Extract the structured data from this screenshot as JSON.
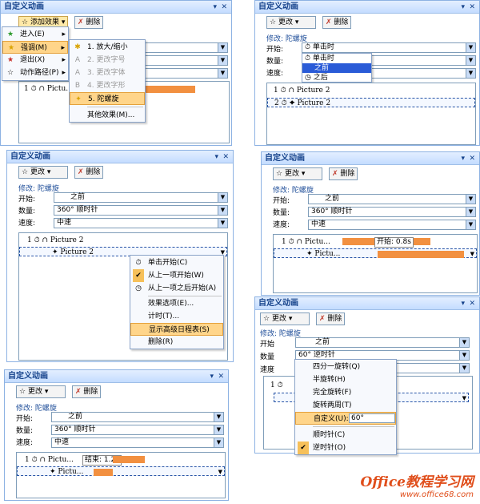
{
  "panel1": {
    "title": "自定义动画",
    "add_effect_label": "添加效果 ▾",
    "delete_label": "删除",
    "list_row": "1 ⏱ ∩ Pictu...",
    "main_menu": [
      {
        "label": "进入(E)",
        "icon": "star-green-icon"
      },
      {
        "label": "强调(M)",
        "icon": "star-yellow-icon"
      },
      {
        "label": "退出(X)",
        "icon": "star-red-icon"
      },
      {
        "label": "动作路径(P)",
        "icon": "star-outline-icon"
      }
    ],
    "submenu": [
      {
        "label": "1. 放大/缩小",
        "disabled": false
      },
      {
        "label": "2. 更改字号",
        "disabled": true
      },
      {
        "label": "3. 更改字体",
        "disabled": true
      },
      {
        "label": "4. 更改字形",
        "disabled": true
      },
      {
        "label": "5. 陀螺旋",
        "disabled": false
      },
      {
        "label": "其他效果(M)...",
        "disabled": false
      }
    ]
  },
  "panel2": {
    "title": "自定义动画",
    "change_label": "更改",
    "delete_label": "删除",
    "modify_label": "修改: 陀螺旋",
    "start_label": "开始:",
    "start_value": "单击时",
    "quantity_label": "数量:",
    "speed_label": "速度:",
    "start_options": [
      "单击时",
      "之前",
      "之后"
    ],
    "rows": [
      "1 ⏱ ∩ Picture 2",
      "2 ⏱ ✦ Picture 2"
    ]
  },
  "panel3": {
    "title": "自定义动画",
    "change_label": "更改",
    "delete_label": "删除",
    "modify_label": "修改: 陀螺旋",
    "start_label": "开始:",
    "start_value": "之前",
    "quantity_label": "数量:",
    "quantity_value": "360°  顺时针",
    "speed_label": "速度:",
    "speed_value": "中速",
    "rows": [
      "1 ⏱ ∩ Picture 2",
      "✦ Picture 2"
    ],
    "context_menu": [
      "单击开始(C)",
      "从上一项开始(W)",
      "从上一项之后开始(A)",
      "效果选项(E)...",
      "计时(T)...",
      "显示高级日程表(S)",
      "删除(R)"
    ]
  },
  "panel4": {
    "title": "自定义动画",
    "change_label": "更改",
    "delete_label": "删除",
    "modify_label": "修改: 陀螺旋",
    "start_label": "开始:",
    "start_value": "之前",
    "quantity_label": "数量:",
    "quantity_value": "360°  顺时针",
    "speed_label": "速度:",
    "speed_value": "中速",
    "rows": [
      "1 ⏱ ∩ Pictu...",
      "✦ Pictu..."
    ],
    "tooltip": "开始: 0.8s"
  },
  "panel5": {
    "title": "自定义动画",
    "change_label": "更改",
    "delete_label": "删除",
    "modify_label": "修改: 陀螺旋",
    "start_label": "开始:",
    "start_value": "之前",
    "quantity_label": "数量:",
    "quantity_value": "360°  顺时针",
    "speed_label": "速度:",
    "speed_value": "中速",
    "rows": [
      "1 ⏱ ∩ Pictu...",
      "✦ Pictu..."
    ],
    "tooltip": "结束: 1.2s"
  },
  "panel6": {
    "title": "自定义动画",
    "change_label": "更改",
    "delete_label": "删除",
    "modify_label": "修改: 陀螺旋",
    "start_label": "开始",
    "start_value": "之前",
    "quantity_label": "数量",
    "quantity_value": "60°  逆时针",
    "speed_label": "速度",
    "row1": "1 ⏱",
    "quantity_menu": [
      "四分一旋转(Q)",
      "半旋转(H)",
      "完全旋转(F)",
      "旋转两周(T)",
      "自定义(U):",
      "顺时针(C)",
      "逆时针(O)"
    ],
    "custom_value": "60°"
  },
  "watermark": {
    "line1": "Office教程学习网",
    "line2": "www.office68.com"
  },
  "colors": {
    "accent_orange": "#f29040",
    "title_blue": "#15428b",
    "highlight": "#ffd58a"
  }
}
